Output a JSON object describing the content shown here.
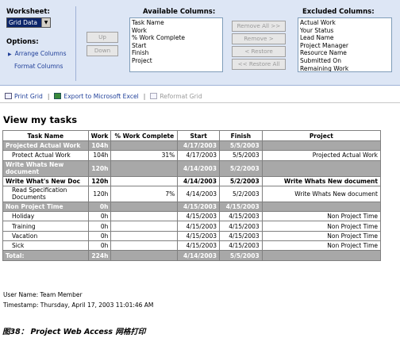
{
  "worksheet": {
    "label": "Worksheet:",
    "value": "Grid Data"
  },
  "options": {
    "label": "Options:",
    "arrange": "Arrange Columns",
    "format": "Format Columns"
  },
  "available": {
    "label": "Available Columns:",
    "items": [
      "Task Name",
      "Work",
      "% Work Complete",
      "Start",
      "Finish",
      "Project"
    ]
  },
  "move": {
    "up": "Up",
    "down": "Down"
  },
  "transfer": {
    "remove_all": "Remove All >>",
    "remove": "Remove >",
    "restore": "< Restore",
    "restore_all": "<< Restore All"
  },
  "excluded": {
    "label": "Excluded Columns:",
    "items": [
      "Actual Work",
      "Your Status",
      "Lead Name",
      "Project Manager",
      "Resource Name",
      "Submitted On",
      "Remaining Work"
    ]
  },
  "toolbar": {
    "print": "Print Grid",
    "export": "Export to Microsoft Excel",
    "reformat": "Reformat Grid",
    "sep": "|"
  },
  "page_title": "View my tasks",
  "table": {
    "headers": [
      "Task Name",
      "Work",
      "% Work Complete",
      "Start",
      "Finish",
      "Project"
    ],
    "rows": [
      {
        "style": "summary",
        "cells": [
          "Projected Actual Work",
          "104h",
          "",
          "4/17/2003",
          "5/5/2003",
          ""
        ]
      },
      {
        "style": "normal",
        "cells": [
          "Protect Actual Work",
          "104h",
          "31%",
          "4/17/2003",
          "5/5/2003",
          "Projected Actual Work"
        ]
      },
      {
        "style": "summary",
        "cells": [
          "Write Whats New document",
          "120h",
          "",
          "4/14/2003",
          "5/2/2003",
          ""
        ]
      },
      {
        "style": "bold",
        "cells": [
          "Write What's New Doc",
          "120h",
          "",
          "4/14/2003",
          "5/2/2003",
          "Write Whats New document"
        ]
      },
      {
        "style": "normal",
        "cells": [
          "Read Specification Documents",
          "120h",
          "7%",
          "4/14/2003",
          "5/2/2003",
          "Write Whats New document"
        ]
      },
      {
        "style": "summary",
        "cells": [
          "Non Project Time",
          "0h",
          "",
          "4/15/2003",
          "4/15/2003",
          ""
        ]
      },
      {
        "style": "normal",
        "cells": [
          "Holiday",
          "0h",
          "",
          "4/15/2003",
          "4/15/2003",
          "Non Project Time"
        ]
      },
      {
        "style": "normal",
        "cells": [
          "Training",
          "0h",
          "",
          "4/15/2003",
          "4/15/2003",
          "Non Project Time"
        ]
      },
      {
        "style": "normal",
        "cells": [
          "Vacation",
          "0h",
          "",
          "4/15/2003",
          "4/15/2003",
          "Non Project Time"
        ]
      },
      {
        "style": "normal",
        "cells": [
          "Sick",
          "0h",
          "",
          "4/15/2003",
          "4/15/2003",
          "Non Project Time"
        ]
      },
      {
        "style": "summary",
        "cells": [
          "Total:",
          "224h",
          "",
          "4/14/2003",
          "5/5/2003",
          ""
        ]
      }
    ]
  },
  "footer": {
    "user": "User Name: Team Member",
    "timestamp": "Timestamp: Thursday, April 17, 2003 11:01:46 AM"
  },
  "caption": "图38： Project Web Access 网格打印"
}
